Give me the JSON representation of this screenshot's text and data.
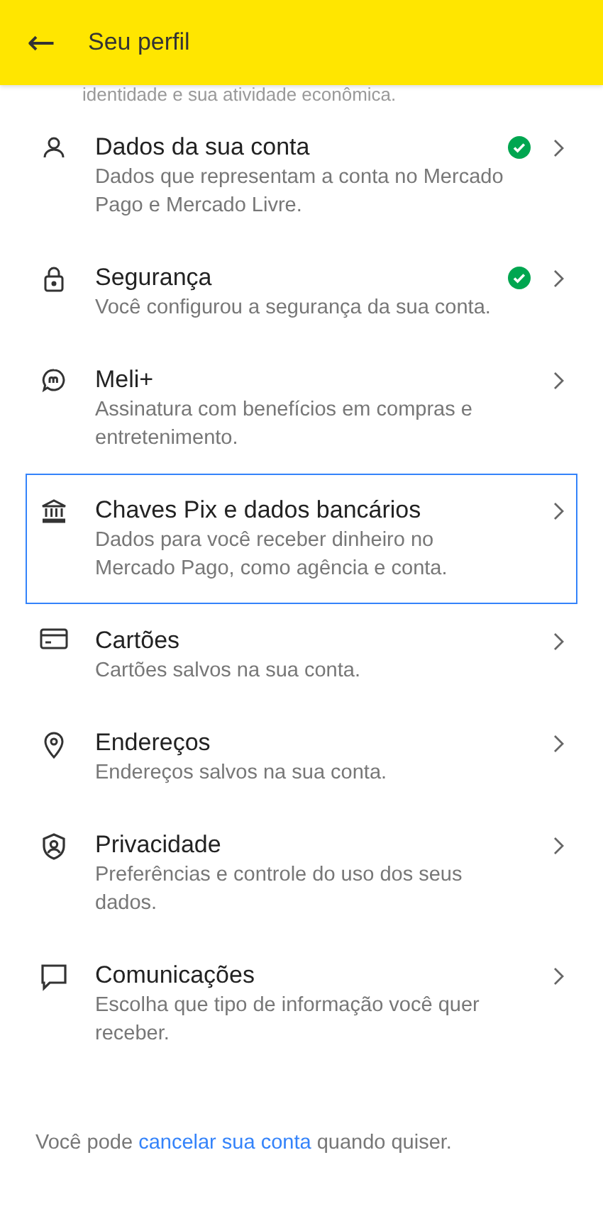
{
  "header": {
    "title": "Seu perfil",
    "back_icon": "←"
  },
  "cut_text": "identidade e sua atividade econômica.",
  "items": [
    {
      "title": "Dados da sua conta",
      "description": "Dados que representam a conta no Mercado Pago e Mercado Livre.",
      "verified": true,
      "selected": false
    },
    {
      "title": "Segurança",
      "description": "Você configurou a segurança da sua conta.",
      "verified": true,
      "selected": false
    },
    {
      "title": "Meli+",
      "description": "Assinatura com benefícios em compras e entretenimento.",
      "verified": false,
      "selected": false
    },
    {
      "title": "Chaves Pix e dados bancários",
      "description": "Dados para você receber dinheiro no Mercado Pago, como agência e conta.",
      "verified": false,
      "selected": true
    },
    {
      "title": "Cartões",
      "description": "Cartões salvos na sua conta.",
      "verified": false,
      "selected": false
    },
    {
      "title": "Endereços",
      "description": "Endereços salvos na sua conta.",
      "verified": false,
      "selected": false
    },
    {
      "title": "Privacidade",
      "description": "Preferências e controle do uso dos seus dados.",
      "verified": false,
      "selected": false
    },
    {
      "title": "Comunicações",
      "description": "Escolha que tipo de informação você quer receber.",
      "verified": false,
      "selected": false
    }
  ],
  "footer": {
    "before": "Você pode ",
    "link": "cancelar sua conta",
    "after": " quando quiser."
  }
}
